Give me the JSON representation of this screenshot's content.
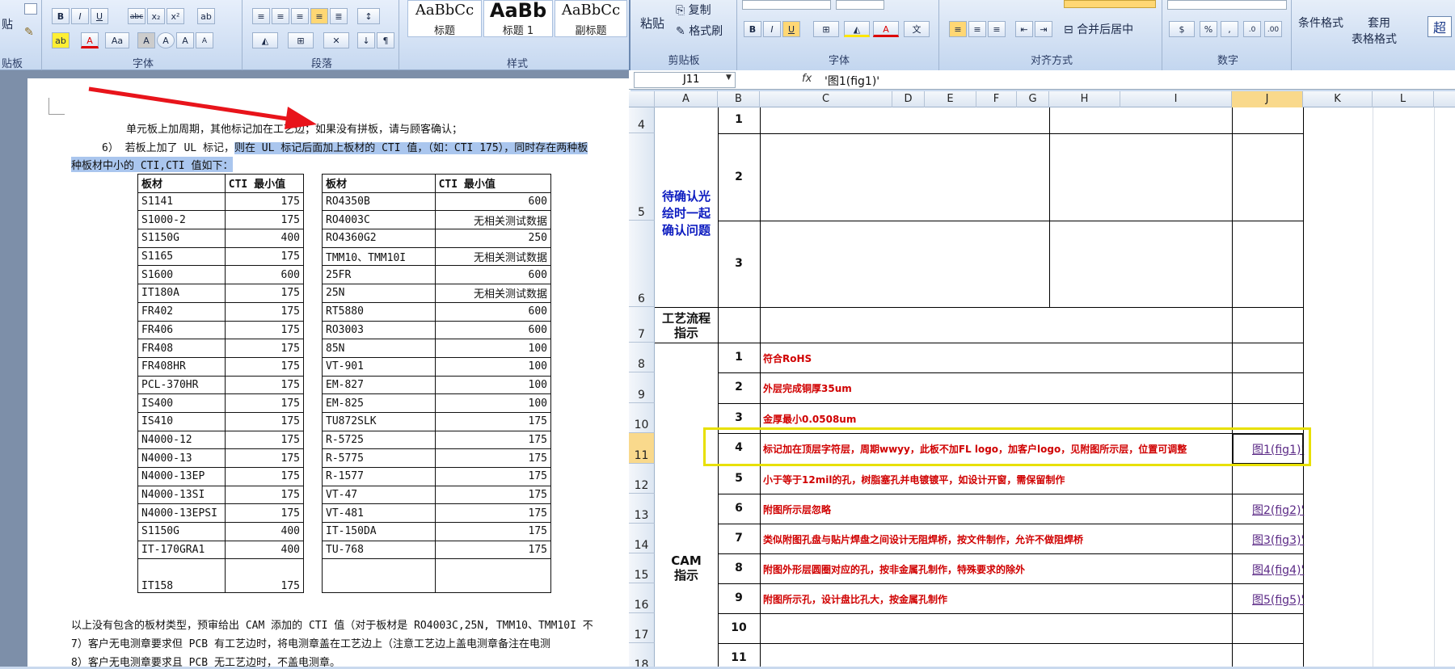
{
  "word": {
    "ribbon": {
      "paste_label": "贴",
      "groups": {
        "clipboard": "贴板",
        "font": "字体",
        "paragraph": "段落",
        "styles": "样式"
      },
      "font_buttons": [
        "B",
        "I",
        "U",
        "abc",
        "x₂",
        "x²",
        "ab",
        "A",
        "Aa",
        "A",
        "A",
        "A",
        "A"
      ],
      "styles": [
        {
          "sample": "AaBbCc",
          "name": "标题"
        },
        {
          "sample": "AaBb",
          "name": "标题 1"
        },
        {
          "sample": "AaBbCc",
          "name": "副标题"
        }
      ]
    },
    "doc": {
      "line1": "单元板上加周期，其他标记加在工艺边；如果没有拼板，请与顾客确认；",
      "line2_pre": "6） 若板上加了 UL 标记，",
      "line2_sel": "则在 UL 标记后面加上板材的 CTI 值，（如：CTI 175），同时存在两种板",
      "line3_sel": "种板材中小的 CTI,CTI 值如下：",
      "table_headers": [
        "板材",
        "CTI 最小值",
        "板材",
        "CTI 最小值"
      ],
      "table_left": [
        [
          "S1141",
          "175"
        ],
        [
          "S1000-2",
          "175"
        ],
        [
          "S1150G",
          "400"
        ],
        [
          "S1165",
          "175"
        ],
        [
          "S1600",
          "600"
        ],
        [
          "IT180A",
          "175"
        ],
        [
          "FR402",
          "175"
        ],
        [
          "FR406",
          "175"
        ],
        [
          "FR408",
          "175"
        ],
        [
          "FR408HR",
          "175"
        ],
        [
          "PCL-370HR",
          "175"
        ],
        [
          "IS400",
          "175"
        ],
        [
          "IS410",
          "175"
        ],
        [
          "N4000-12",
          "175"
        ],
        [
          "N4000-13",
          "175"
        ],
        [
          "N4000-13EP",
          "175"
        ],
        [
          "N4000-13SI",
          "175"
        ],
        [
          "N4000-13EPSI",
          "175"
        ],
        [
          "S1150G",
          "400"
        ],
        [
          "IT-170GRA1",
          "400"
        ],
        [
          "IT158",
          "175"
        ]
      ],
      "table_right": [
        [
          "RO4350B",
          "600"
        ],
        [
          "RO4003C",
          "无相关测试数据"
        ],
        [
          "RO4360G2",
          "250"
        ],
        [
          "TMM10、TMM10I",
          "无相关测试数据"
        ],
        [
          "25FR",
          "600"
        ],
        [
          "25N",
          "无相关测试数据"
        ],
        [
          "RT5880",
          "600"
        ],
        [
          "RO3003",
          "600"
        ],
        [
          "85N",
          "100"
        ],
        [
          "VT-901",
          "100"
        ],
        [
          "EM-827",
          "100"
        ],
        [
          "EM-825",
          "100"
        ],
        [
          "TU872SLK",
          "175"
        ],
        [
          "R-5725",
          "175"
        ],
        [
          "R-5775",
          "175"
        ],
        [
          "R-1577",
          "175"
        ],
        [
          "VT-47",
          "175"
        ],
        [
          "VT-481",
          "175"
        ],
        [
          "IT-150DA",
          "175"
        ],
        [
          "TU-768",
          "175"
        ],
        [
          "",
          ""
        ]
      ],
      "after1": "以上没有包含的板材类型，预审给出 CAM 添加的 CTI  值（对于板材是 RO4003C,25N, TMM10、TMM10I 不",
      "after2": "7）客户无电测章要求但 PCB 有工艺边时，将电测章盖在工艺边上（注意工艺边上盖电测章备注在电测",
      "after3": "8）客户无电测章要求且 PCB 无工艺边时，不盖电测章。"
    }
  },
  "excel": {
    "ribbon": {
      "paste": "粘贴",
      "copy": "复制",
      "format_painter": "格式刷",
      "groups": {
        "clipboard": "剪贴板",
        "font": "字体",
        "alignment": "对齐方式",
        "number": "数字"
      },
      "merge_center": "合并后居中",
      "conditional_format": "条件格式",
      "table_format_1": "套用",
      "table_format_2": "表格格式",
      "number_buttons": [
        "%",
        ","
      ]
    },
    "name_box": "J11",
    "formula": "'图1(fig1)'",
    "fx": "fx",
    "columns": [
      "A",
      "B",
      "C",
      "D",
      "E",
      "F",
      "G",
      "H",
      "I",
      "J",
      "K",
      "L"
    ],
    "rows": [
      "4",
      "5",
      "6",
      "7",
      "8",
      "9",
      "10",
      "11",
      "12",
      "13",
      "14",
      "15",
      "16",
      "17",
      "18"
    ],
    "section_confirm": "待确认光绘时一起确认问题",
    "section_process_1": "工艺流程",
    "section_process_2": "指示",
    "section_cam_1": "CAM",
    "section_cam_2": "指示",
    "confirm_items": [
      "1",
      "2",
      "3"
    ],
    "cam_items": [
      {
        "num": "1",
        "text": "符合RoHS",
        "link": ""
      },
      {
        "num": "2",
        "text": "外层完成铜厚35um",
        "link": ""
      },
      {
        "num": "3",
        "text": "金厚最小0.0508um",
        "link": ""
      },
      {
        "num": "4",
        "text": "标记加在顶层字符层，周期wwyy，此板不加FL logo，加客户logo，见附图所示层，位置可调整",
        "link": "图1(fig1)'"
      },
      {
        "num": "5",
        "text": "小于等于12mil的孔，树脂塞孔并电镀镀平，如设计开窗，需保留制作",
        "link": ""
      },
      {
        "num": "6",
        "text": "附图所示层忽略",
        "link": "图2(fig2)'"
      },
      {
        "num": "7",
        "text": "类似附图孔盘与贴片焊盘之间设计无阻焊桥，按文件制作，允许不做阻焊桥",
        "link": "图3(fig3)'"
      },
      {
        "num": "8",
        "text": "附图外形层圆圈对应的孔，按非金属孔制作，特殊要求的除外",
        "link": "图4(fig4)'"
      },
      {
        "num": "9",
        "text": "附图所示孔，设计盘比孔大，按金属孔制作",
        "link": "图5(fig5)'"
      },
      {
        "num": "10",
        "text": "",
        "link": ""
      },
      {
        "num": "11",
        "text": "",
        "link": ""
      }
    ],
    "highlight_color": "#e8e000",
    "arrow_color": "#e8141b"
  }
}
